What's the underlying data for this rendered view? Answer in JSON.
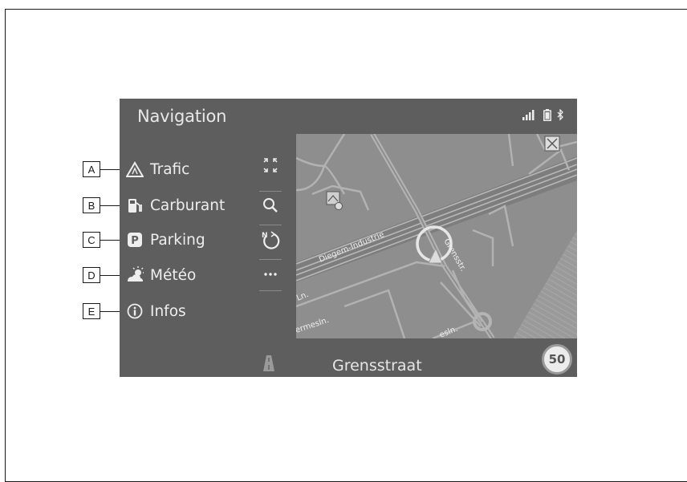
{
  "screen": {
    "title": "Navigation",
    "street_name": "Grensstraat",
    "speed_limit": "50"
  },
  "status_icons": [
    "signal-bars-icon",
    "battery-icon",
    "bluetooth-icon"
  ],
  "menu": [
    {
      "label": "Trafic",
      "icon": "traffic-warning-icon",
      "callout": "A"
    },
    {
      "label": "Carburant",
      "icon": "fuel-pump-icon",
      "callout": "B"
    },
    {
      "label": "Parking",
      "icon": "parking-icon",
      "callout": "C"
    },
    {
      "label": "Météo",
      "icon": "weather-icon",
      "callout": "D"
    },
    {
      "label": "Infos",
      "icon": "info-icon",
      "callout": "E"
    }
  ],
  "map_controls": [
    "fullscreen-icon",
    "search-icon",
    "compass-north-icon",
    "more-options-icon"
  ],
  "map_labels": {
    "road1": "Diegem-Industrie",
    "road2": "Ln.",
    "road3": "ermesln.",
    "road4": "Grensstr.",
    "road5": "esln."
  },
  "colors": {
    "screen_bg": "#5e5e5e",
    "map_bg": "#8b8b8b",
    "text": "#eeeeee"
  }
}
